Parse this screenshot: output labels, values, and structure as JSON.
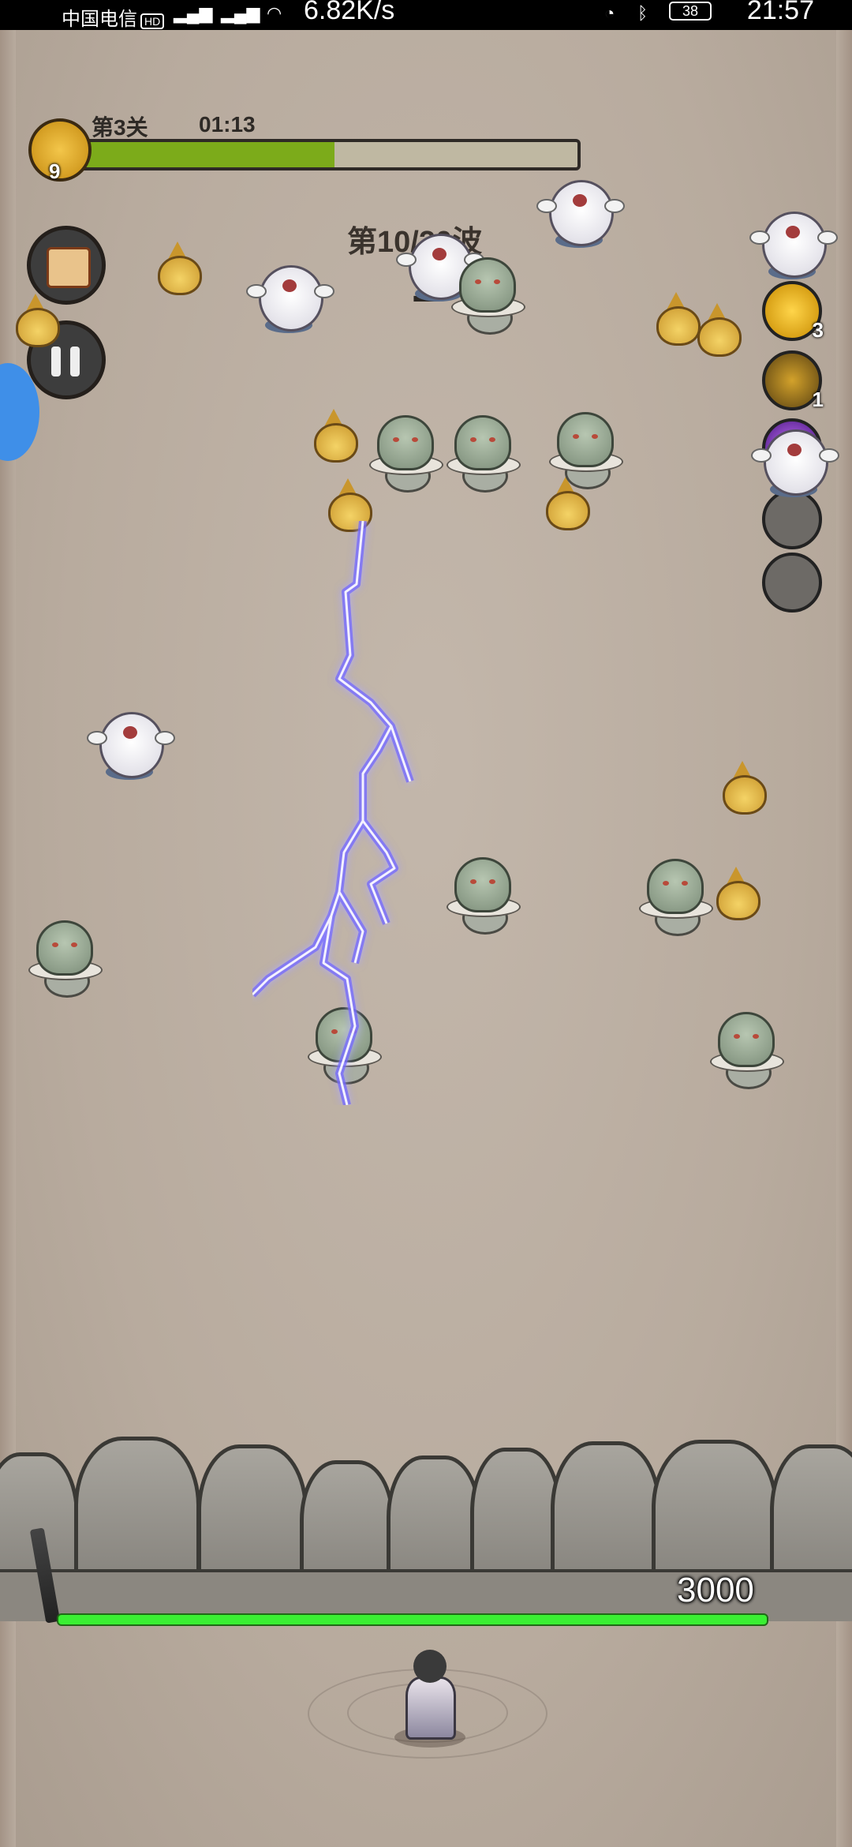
{
  "status_bar": {
    "carrier": "中国电信",
    "hd": "HD",
    "speed": "6.82K/s",
    "battery": "38",
    "time": "21:57"
  },
  "hud": {
    "stage": "第3关",
    "timer": "01:13",
    "level_badge": "9",
    "stage_progress": 0.51
  },
  "wave": {
    "label": "第10/20波",
    "countdown": "1"
  },
  "skills": [
    {
      "name": "golden-wing-skill",
      "count": "3"
    },
    {
      "name": "lightning-skill",
      "count": "1"
    },
    {
      "name": "purple-lightning-skill",
      "count": "2"
    },
    {
      "name": "empty-skill-slot",
      "count": ""
    },
    {
      "name": "empty-skill-slot",
      "count": ""
    }
  ],
  "base": {
    "hp": "3000",
    "hp_ratio": 1.0
  },
  "colors": {
    "progress_fill": "#7cab1a",
    "hp_bar": "#3aef33",
    "lightning": "#7d6cff"
  }
}
